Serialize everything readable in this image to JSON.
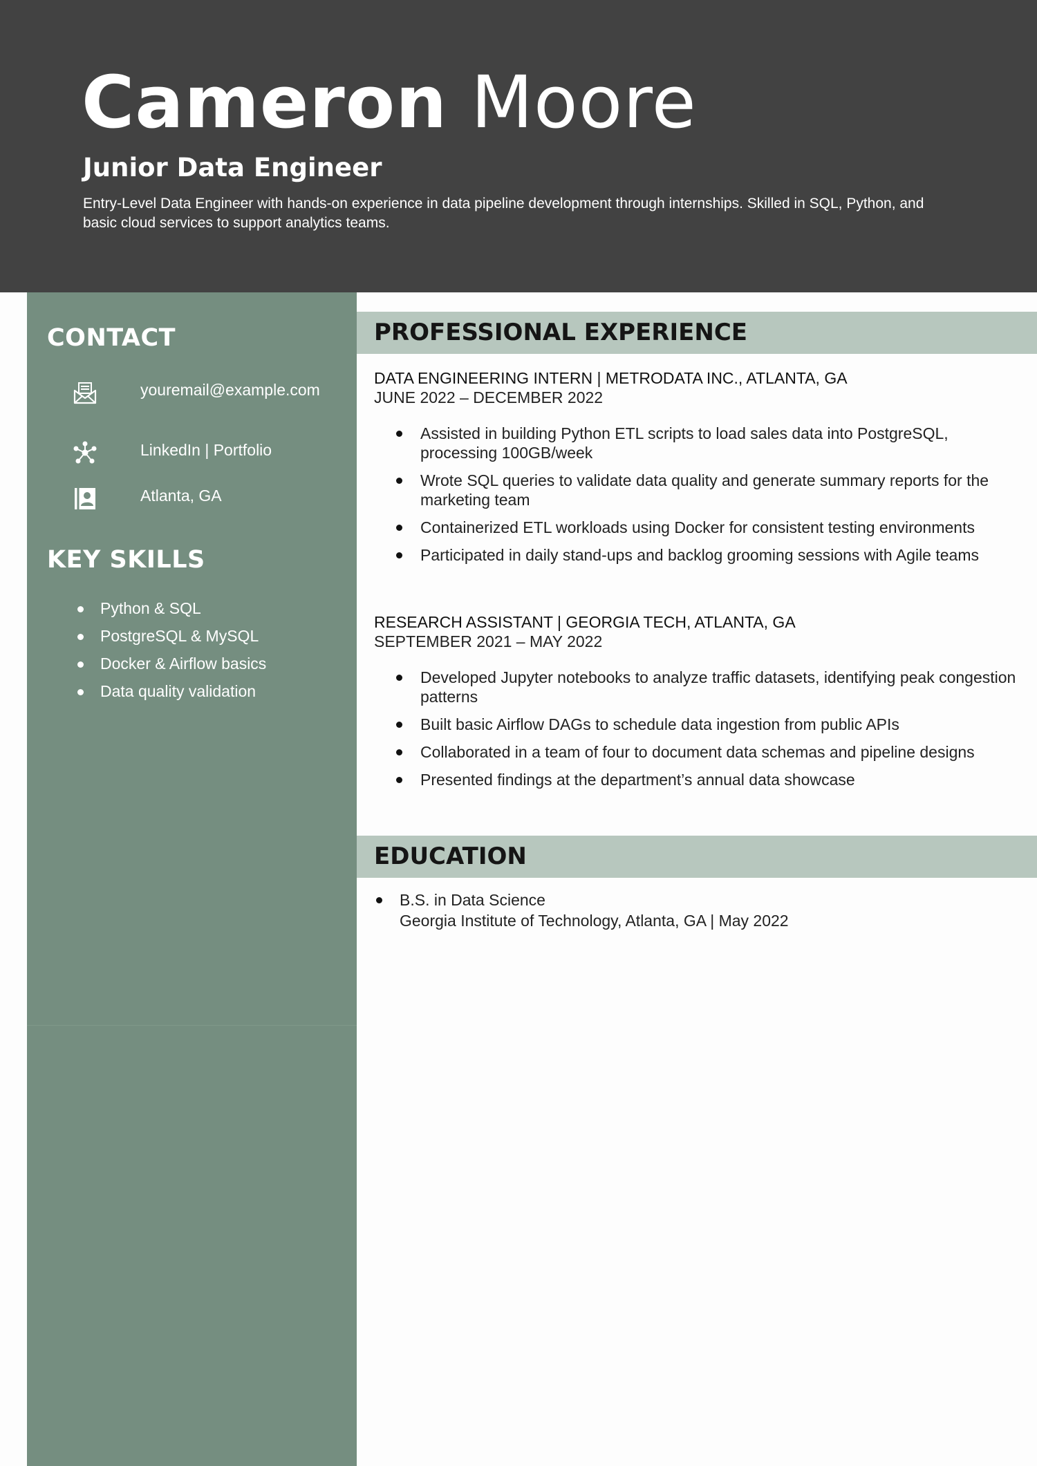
{
  "header": {
    "first_name": "Cameron",
    "last_name": "Moore",
    "job_title": "Junior Data Engineer",
    "summary": "Entry-Level Data Engineer with hands-on experience in data pipeline development through internships. Skilled in SQL, Python, and basic cloud services to support analytics teams."
  },
  "contact": {
    "heading": "CONTACT",
    "email": "youremail@example.com",
    "links": "LinkedIn | Portfolio",
    "location": "Atlanta, GA"
  },
  "skills": {
    "heading": "KEY SKILLS",
    "items": [
      "Python & SQL",
      "PostgreSQL & MySQL",
      "Docker & Airflow basics",
      "Data quality validation"
    ]
  },
  "experience": {
    "heading": "PROFESSIONAL EXPERIENCE",
    "jobs": [
      {
        "title": "DATA ENGINEERING INTERN | METRODATA INC., ATLANTA, GA",
        "dates": "JUNE 2022 – DECEMBER 2022",
        "bullets": [
          "Assisted in building Python ETL scripts to load sales data into PostgreSQL, processing 100GB/week",
          "Wrote SQL queries to validate data quality and generate summary reports for the marketing team",
          "Containerized ETL workloads using Docker for consistent testing environments",
          "Participated in daily stand-ups and backlog grooming sessions with Agile teams"
        ]
      },
      {
        "title": "RESEARCH ASSISTANT | GEORGIA TECH, ATLANTA, GA",
        "dates": "SEPTEMBER 2021 – MAY 2022",
        "bullets": [
          "Developed Jupyter notebooks to analyze traffic datasets, identifying peak congestion patterns",
          "Built basic Airflow DAGs to schedule data ingestion from public APIs",
          "Collaborated in a team of four to document data schemas and pipeline designs",
          "Presented findings at the department’s annual data showcase"
        ]
      }
    ]
  },
  "education": {
    "heading": "EDUCATION",
    "degree": "B.S. in Data Science",
    "school": "Georgia Institute of Technology, Atlanta, GA | May 2022"
  },
  "colors": {
    "header_bg": "#424242",
    "sidebar_bg": "#758e80",
    "section_bar_bg": "#b7c7be",
    "page_bg": "#fdfdfd"
  }
}
